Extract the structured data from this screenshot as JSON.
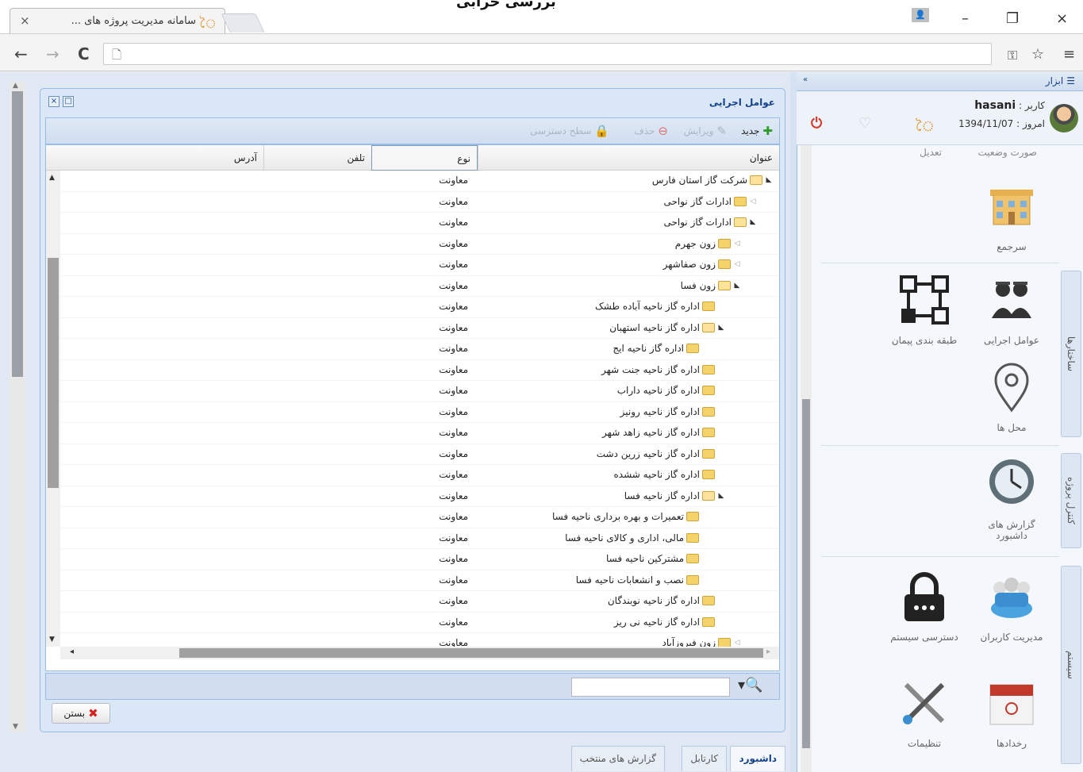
{
  "browser": {
    "tab_title": "سامانه مدیریت پروژه های ...",
    "tab_close": "×",
    "title_fragment": "بررسی خرابی",
    "win_minimize": "–",
    "win_restore": "▫",
    "win_close": "×",
    "nav_back": "←",
    "nav_forward": "→",
    "nav_reload": "C",
    "address": ""
  },
  "window": {
    "title": "عوامل اجرایی",
    "toolbar": {
      "new_label": "جدید",
      "edit_label": "ویرایش",
      "delete_label": "حذف",
      "access_label": "سطح دسترسی"
    },
    "columns": {
      "title": "عنوان",
      "type": "نوع",
      "phone": "تلفن",
      "address": "آدرس"
    },
    "rows": [
      {
        "title": "شرکت گاز استان فارس",
        "type": "معاونت",
        "level": 0,
        "expander": "open"
      },
      {
        "title": "ادارات گاز نواحی",
        "type": "معاونت",
        "level": 1,
        "expander": "closed"
      },
      {
        "title": "ادارات گاز نواحی",
        "type": "معاونت",
        "level": 1,
        "expander": "open"
      },
      {
        "title": "زون جهرم",
        "type": "معاونت",
        "level": 2,
        "expander": "closed"
      },
      {
        "title": "زون صفاشهر",
        "type": "معاونت",
        "level": 2,
        "expander": "closed"
      },
      {
        "title": "زون فسا",
        "type": "معاونت",
        "level": 2,
        "expander": "open"
      },
      {
        "title": "اداره گاز ناحیه آباده طشک",
        "type": "معاونت",
        "level": 3,
        "expander": "none"
      },
      {
        "title": "اداره گاز ناحیه استهبان",
        "type": "معاونت",
        "level": 3,
        "expander": "open"
      },
      {
        "title": "اداره گاز ناحیه ایج",
        "type": "معاونت",
        "level": 4,
        "expander": "none"
      },
      {
        "title": "اداره گاز ناحیه جنت شهر",
        "type": "معاونت",
        "level": 3,
        "expander": "none"
      },
      {
        "title": "اداره گاز ناحیه داراب",
        "type": "معاونت",
        "level": 3,
        "expander": "none"
      },
      {
        "title": "اداره گاز ناحیه رونیز",
        "type": "معاونت",
        "level": 3,
        "expander": "none"
      },
      {
        "title": "اداره گاز ناحیه زاهد شهر",
        "type": "معاونت",
        "level": 3,
        "expander": "none"
      },
      {
        "title": "اداره گاز ناحیه زرین دشت",
        "type": "معاونت",
        "level": 3,
        "expander": "none"
      },
      {
        "title": "اداره گاز ناحیه ششده",
        "type": "معاونت",
        "level": 3,
        "expander": "none"
      },
      {
        "title": "اداره گاز ناحیه فسا",
        "type": "معاونت",
        "level": 3,
        "expander": "open"
      },
      {
        "title": "تعمیرات و بهره برداری ناحیه فسا",
        "type": "معاونت",
        "level": 4,
        "expander": "none"
      },
      {
        "title": "مالی، اداری و کالای ناحیه فسا",
        "type": "معاونت",
        "level": 4,
        "expander": "none"
      },
      {
        "title": "مشترکین ناحیه فسا",
        "type": "معاونت",
        "level": 4,
        "expander": "none"
      },
      {
        "title": "نصب و انشعابات ناحیه فسا",
        "type": "معاونت",
        "level": 4,
        "expander": "none"
      },
      {
        "title": "اداره گاز ناحیه نوبندگان",
        "type": "معاونت",
        "level": 3,
        "expander": "none"
      },
      {
        "title": "اداره گاز ناحیه نی ریز",
        "type": "معاونت",
        "level": 3,
        "expander": "none"
      },
      {
        "title": "زون فیروزآباد",
        "type": "معاونت",
        "level": 2,
        "expander": "closed"
      }
    ],
    "search_placeholder": "",
    "close_label": "بستن"
  },
  "bottom_tabs": [
    "داشبورد",
    "کارتابل",
    "گزارش های منتخب"
  ],
  "sidebar": {
    "menu_label": "ابزار",
    "user_label": "کاربر :",
    "user_name": "hasani",
    "date_label": "امروز :",
    "date_value": "1394/11/07",
    "col_status": "صورت وضعیت",
    "col_edit": "تعدیل",
    "groups": {
      "structures": "ساختارها",
      "project_control": "کنترل پروژه",
      "system": "سیستم"
    },
    "items": {
      "base": "سرجمع",
      "execution_agents": "عوامل اجرایی",
      "contract_classification": "طبقه بندی پیمان",
      "locations": "محل ها",
      "dashboard_reports": "گزارش های داشبورد",
      "user_management": "مدیریت کاربران",
      "system_access": "دسترسی سیستم",
      "events": "رخدادها",
      "settings": "تنظیمات"
    }
  },
  "colors": {
    "panel_border": "#99bbe8",
    "title_blue": "#15428b",
    "folder_yellow": "#f5d36b"
  }
}
